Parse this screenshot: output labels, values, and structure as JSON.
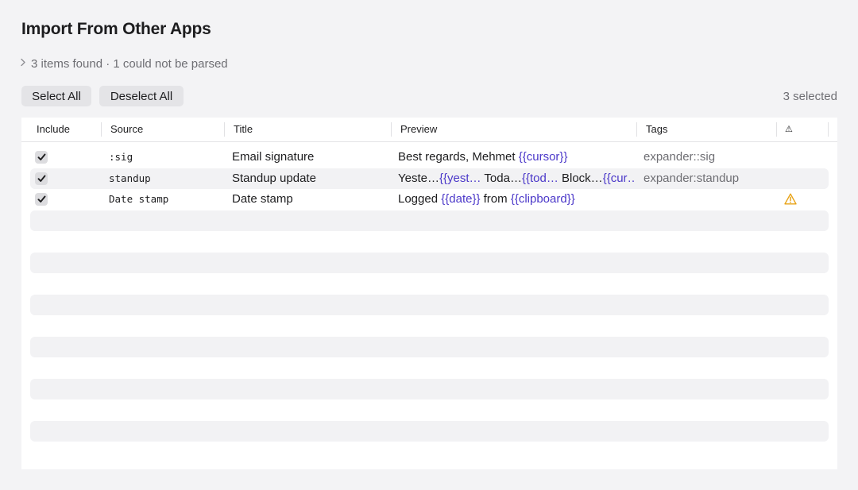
{
  "header": {
    "title": "Import From Other Apps",
    "summary": "3 items found · 1 could not be parsed"
  },
  "toolbar": {
    "select_all": "Select All",
    "deselect_all": "Deselect All",
    "selected_count": "3 selected"
  },
  "table": {
    "columns": {
      "include": "Include",
      "source": "Source",
      "title": "Title",
      "preview": "Preview",
      "tags": "Tags",
      "warning": "⚠"
    },
    "rows": [
      {
        "included": true,
        "source": ":sig",
        "title": "Email signature",
        "preview": [
          {
            "text": "Best regards, Mehmet ",
            "placeholder": false
          },
          {
            "text": "{{cursor}}",
            "placeholder": true
          }
        ],
        "tags": "expander::sig",
        "warning": false
      },
      {
        "included": true,
        "source": "standup",
        "title": "Standup update",
        "preview": [
          {
            "text": "Yeste…",
            "placeholder": false
          },
          {
            "text": "{{yest…",
            "placeholder": true
          },
          {
            "text": " Toda…",
            "placeholder": false
          },
          {
            "text": "{{tod…",
            "placeholder": true
          },
          {
            "text": " Block…",
            "placeholder": false
          },
          {
            "text": "{{cur…",
            "placeholder": true
          }
        ],
        "tags": "expander:standup",
        "warning": false
      },
      {
        "included": true,
        "source": "Date stamp",
        "title": "Date stamp",
        "preview": [
          {
            "text": "Logged ",
            "placeholder": false
          },
          {
            "text": "{{date}}",
            "placeholder": true
          },
          {
            "text": " from ",
            "placeholder": false
          },
          {
            "text": "{{clipboard}}",
            "placeholder": true
          }
        ],
        "tags": "",
        "warning": true
      }
    ],
    "empty_row_count": 12
  },
  "colors": {
    "placeholder": "#4b38c9",
    "warning": "#e8a317",
    "stripe": "#f2f2f4"
  },
  "icons": {
    "disclosure": "chevron-right-icon",
    "check": "checkmark-icon",
    "warning": "warning-triangle-icon"
  }
}
